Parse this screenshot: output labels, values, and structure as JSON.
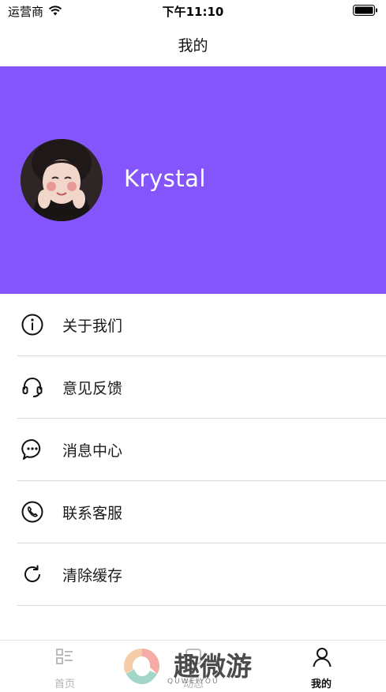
{
  "status_bar": {
    "carrier": "运营商",
    "time": "下午11:10"
  },
  "nav": {
    "title": "我的"
  },
  "profile": {
    "username": "Krystal",
    "header_color": "#8455fb"
  },
  "menu": {
    "items": [
      {
        "label": "关于我们",
        "icon": "info-icon"
      },
      {
        "label": "意见反馈",
        "icon": "headset-icon"
      },
      {
        "label": "消息中心",
        "icon": "chat-bubble-icon"
      },
      {
        "label": "联系客服",
        "icon": "phone-icon"
      },
      {
        "label": "清除缓存",
        "icon": "refresh-icon"
      }
    ]
  },
  "tab_bar": {
    "tabs": [
      {
        "label": "首页",
        "icon": "home-list-icon",
        "active": false
      },
      {
        "label": "动态",
        "icon": "feed-icon",
        "active": false
      },
      {
        "label": "我的",
        "icon": "person-icon",
        "active": true
      }
    ]
  },
  "watermark": {
    "text": "趣微游",
    "subtext": "QUWEIYOU"
  }
}
